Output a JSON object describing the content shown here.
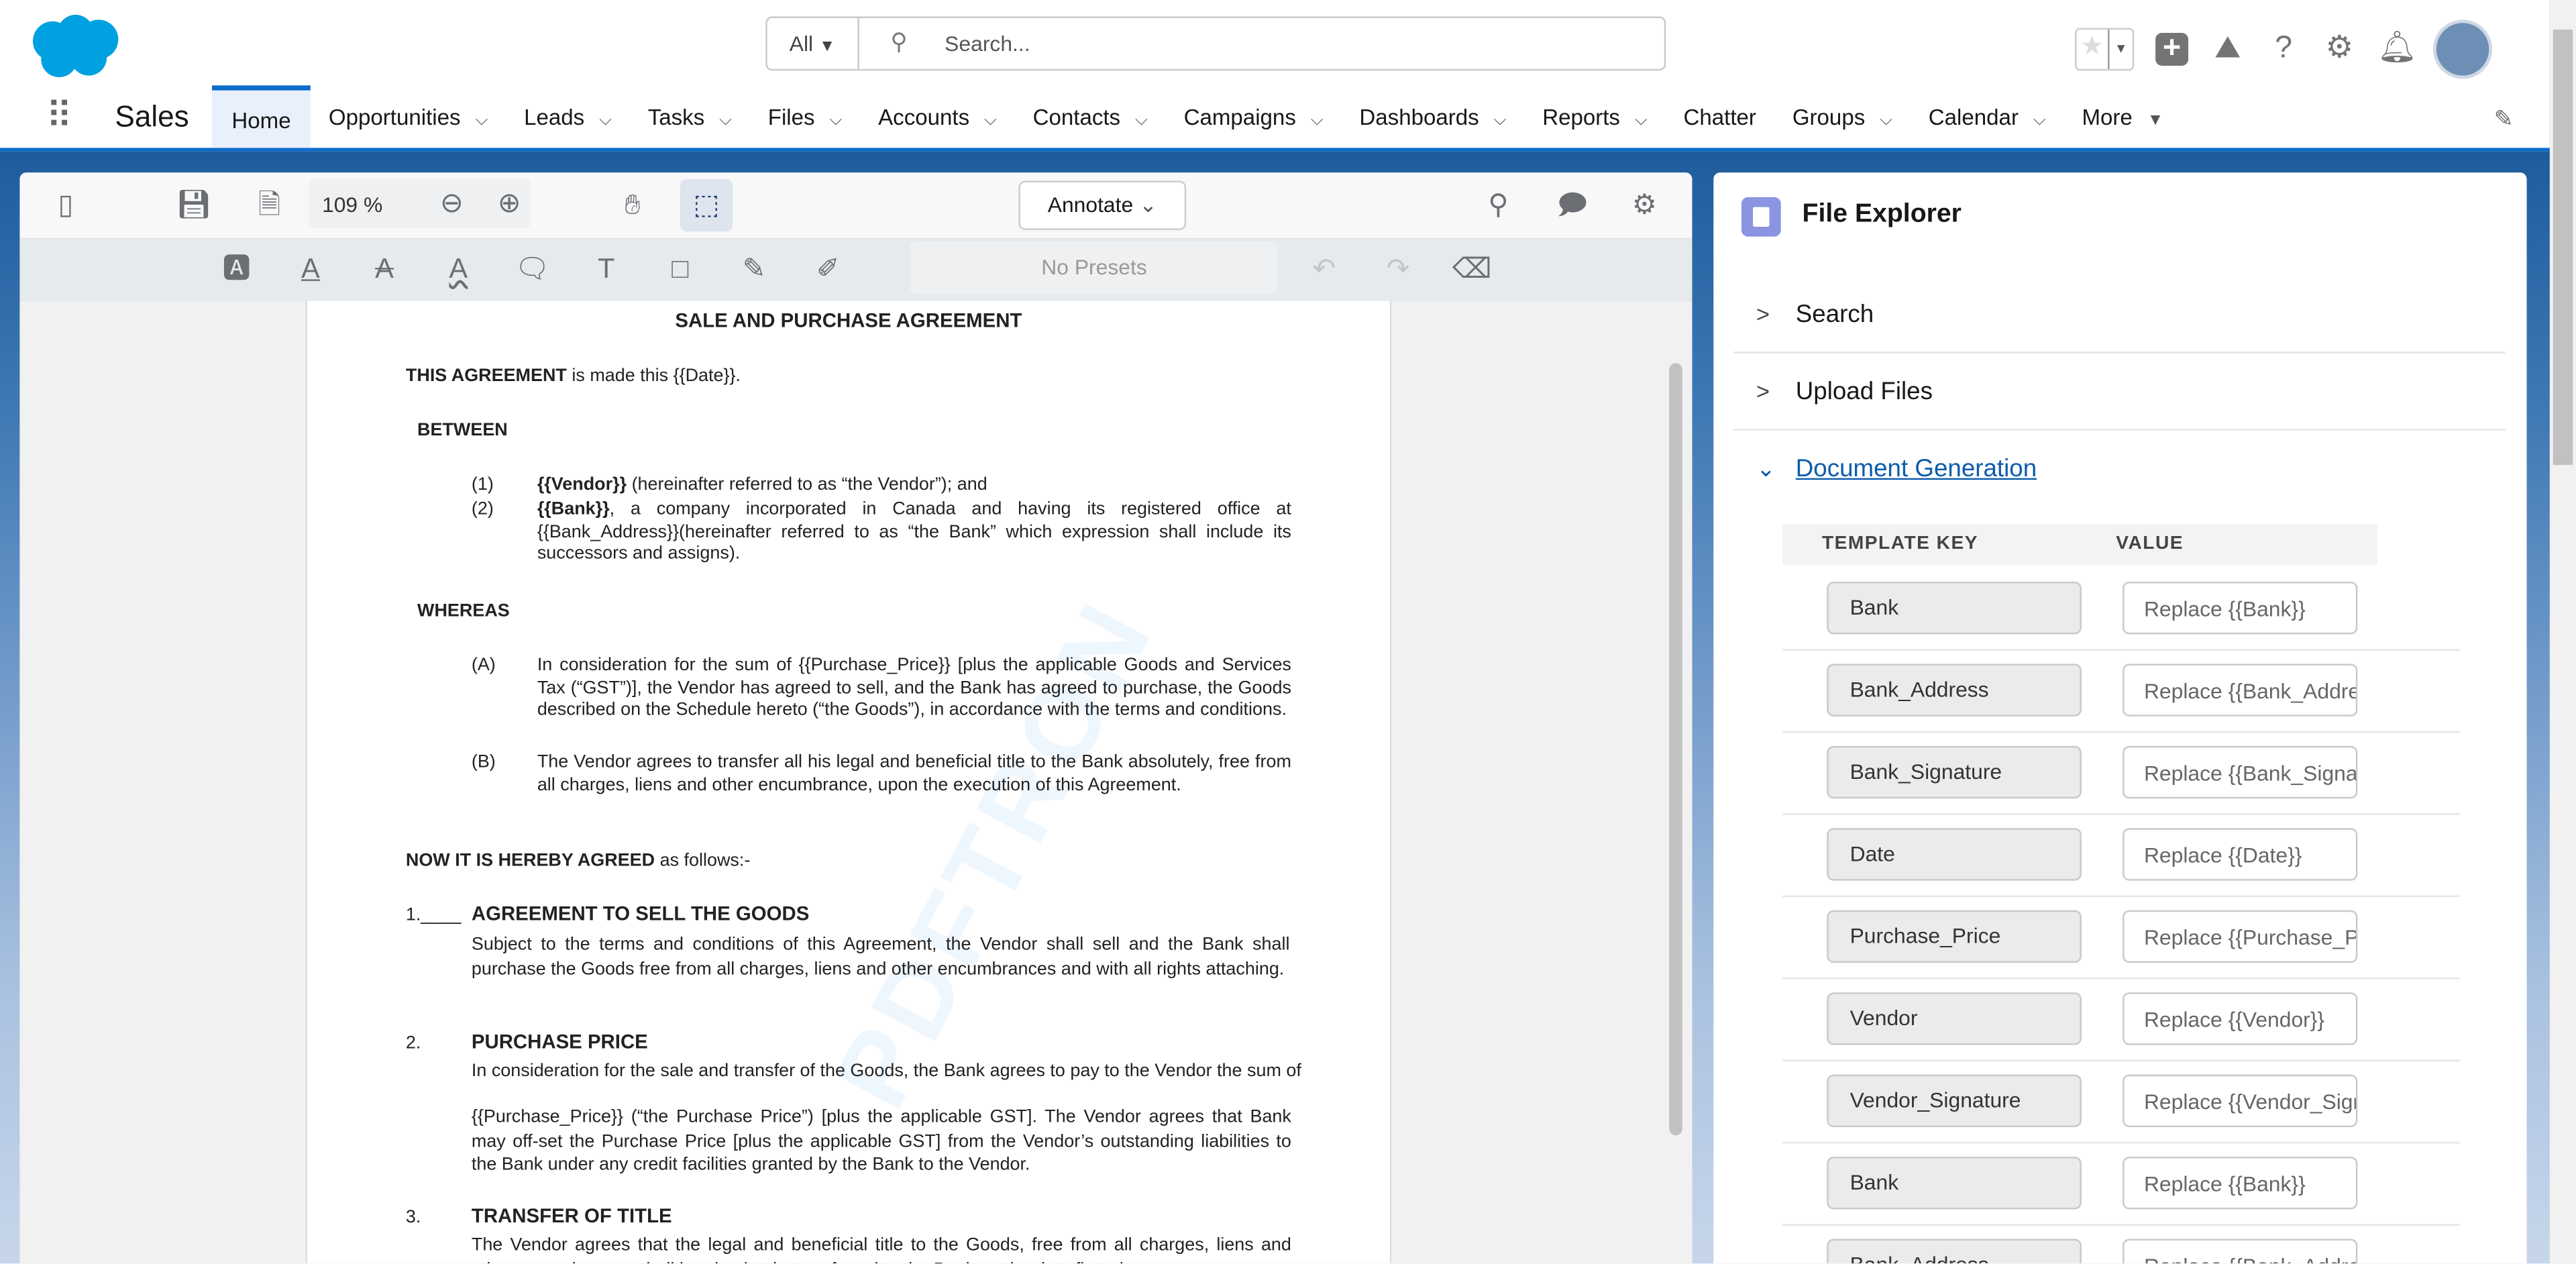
{
  "header": {
    "search_scope": "All",
    "search_placeholder": "Search...",
    "app_name": "Sales"
  },
  "nav": [
    {
      "label": "Home",
      "active": true,
      "menu": false
    },
    {
      "label": "Opportunities",
      "menu": true
    },
    {
      "label": "Leads",
      "menu": true
    },
    {
      "label": "Tasks",
      "menu": true
    },
    {
      "label": "Files",
      "menu": true
    },
    {
      "label": "Accounts",
      "menu": true
    },
    {
      "label": "Contacts",
      "menu": true
    },
    {
      "label": "Campaigns",
      "menu": true
    },
    {
      "label": "Dashboards",
      "menu": true
    },
    {
      "label": "Reports",
      "menu": true
    },
    {
      "label": "Chatter",
      "menu": false
    },
    {
      "label": "Groups",
      "menu": true
    },
    {
      "label": "Calendar",
      "menu": true
    },
    {
      "label": "More",
      "menu": true
    }
  ],
  "viewer": {
    "zoom": "109 %",
    "mode": "Annotate",
    "presets": "No Presets"
  },
  "doc": {
    "title": "SALE AND PURCHASE AGREEMENT",
    "intro_b": "THIS AGREEMENT",
    "intro": " is made this {{Date}}.",
    "between": "BETWEEN",
    "p1_n": "(1)",
    "p1_b": "{{Vendor}}",
    "p1": " (hereinafter referred to as “the Vendor”); and",
    "p2_n": "(2)",
    "p2_b": "{{Bank}}",
    "p2": ", a company incorporated in Canada and having its registered office at {{Bank_Address}}(hereinafter referred to as “the Bank” which expression shall include its successors and assigns).",
    "whereas": "WHEREAS",
    "a_n": "(A)",
    "a": "In consideration for the sum of {{Purchase_Price}} [plus the applicable Goods and Services Tax (“GST”)], the Vendor has agreed to sell, and the Bank has agreed to purchase, the Goods described on the Schedule hereto (“the Goods”), in accordance with the terms and conditions.",
    "b_n": "(B)",
    "b": "The Vendor agrees to transfer all his legal and beneficial title to the Bank absolutely, free from all charges, liens and other encumbrance, upon the execution of this Agreement.",
    "now_b": "NOW IT IS HEREBY AGREED",
    "now": " as follows:-",
    "s1_n": "1.____",
    "s1_t": "AGREEMENT TO SELL THE GOODS",
    "s1": "Subject to the terms and conditions of this Agreement, the Vendor shall sell and the Bank shall purchase the Goods free from all charges, liens and other encumbrances and with all rights attaching.",
    "s2_n": "2.",
    "s2_t": "PURCHASE PRICE",
    "s2a": "In consideration for the sale and transfer of the Goods, the Bank agrees to pay to the Vendor the sum of",
    "s2b": "{{Purchase_Price}} (“the Purchase Price”) [plus the applicable GST]. The Vendor agrees that Bank may off-set the Purchase Price [plus the applicable GST] from the Vendor’s outstanding liabilities to the Bank under any credit facilities granted by the Bank to the Vendor.",
    "s3_n": "3.",
    "s3_t": "TRANSFER OF TITLE",
    "s3": "The Vendor agrees that the legal and beneficial title to the Goods, free from all charges, liens and other encumbrance, shall be absolutely transferred to the Bank on the date first above"
  },
  "explorer": {
    "title": "File Explorer",
    "sections": [
      "Search",
      "Upload Files",
      "Document Generation"
    ],
    "col_key": "TEMPLATE KEY",
    "col_value": "VALUE",
    "rows": [
      {
        "key": "Bank",
        "value": "Replace {{Bank}}"
      },
      {
        "key": "Bank_Address",
        "value": "Replace {{Bank_Address}}"
      },
      {
        "key": "Bank_Signature",
        "value": "Replace {{Bank_Signature}}"
      },
      {
        "key": "Date",
        "value": "Replace {{Date}}"
      },
      {
        "key": "Purchase_Price",
        "value": "Replace {{Purchase_Price}}"
      },
      {
        "key": "Vendor",
        "value": "Replace {{Vendor}}"
      },
      {
        "key": "Vendor_Signature",
        "value": "Replace {{Vendor_Signature}}"
      },
      {
        "key": "Bank",
        "value": "Replace {{Bank}}"
      },
      {
        "key": "Bank_Address",
        "value": "Replace {{Bank_Address}}"
      }
    ]
  },
  "colors": {
    "brand": "#00a1e0",
    "accent": "#0b6bcb",
    "link": "#0b5cab"
  }
}
